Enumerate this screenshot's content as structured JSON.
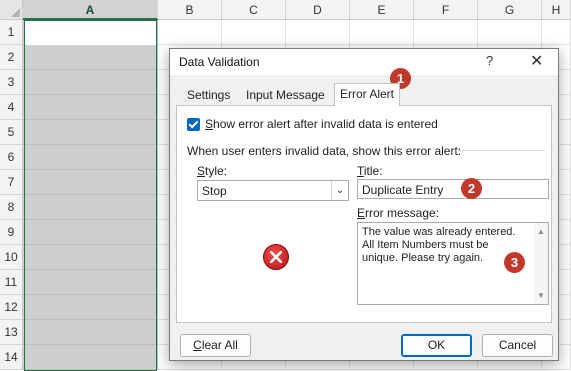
{
  "sheet": {
    "columns": [
      "A",
      "B",
      "C",
      "D",
      "E",
      "F",
      "G",
      "H"
    ],
    "rows": [
      "1",
      "2",
      "3",
      "4",
      "5",
      "6",
      "7",
      "8",
      "9",
      "10",
      "11",
      "12",
      "13",
      "14"
    ],
    "selected_column": "A"
  },
  "dialog": {
    "title": "Data Validation",
    "help_icon": "?",
    "close_icon": "✕",
    "tabs": [
      "Settings",
      "Input Message",
      "Error Alert"
    ],
    "active_tab": "Error Alert",
    "show_alert_label": "Show error alert after invalid data is entered",
    "show_alert_checked": true,
    "group_label": "When user enters invalid data, show this error alert:",
    "style_label": "Style:",
    "style_value": "Stop",
    "title_label": "Title:",
    "title_value": "Duplicate Entry",
    "error_message_label": "Error message:",
    "error_message_value": "The value was already entered.\nAll Item Numbers must be\nunique. Please try again.",
    "clear_all": "Clear All",
    "ok": "OK",
    "cancel": "Cancel"
  },
  "badges": [
    "1",
    "2",
    "3"
  ],
  "colors": {
    "accent": "#217346",
    "badge": "#c0392b",
    "checkbox": "#0067c0",
    "error_icon": "#d32f2f"
  }
}
